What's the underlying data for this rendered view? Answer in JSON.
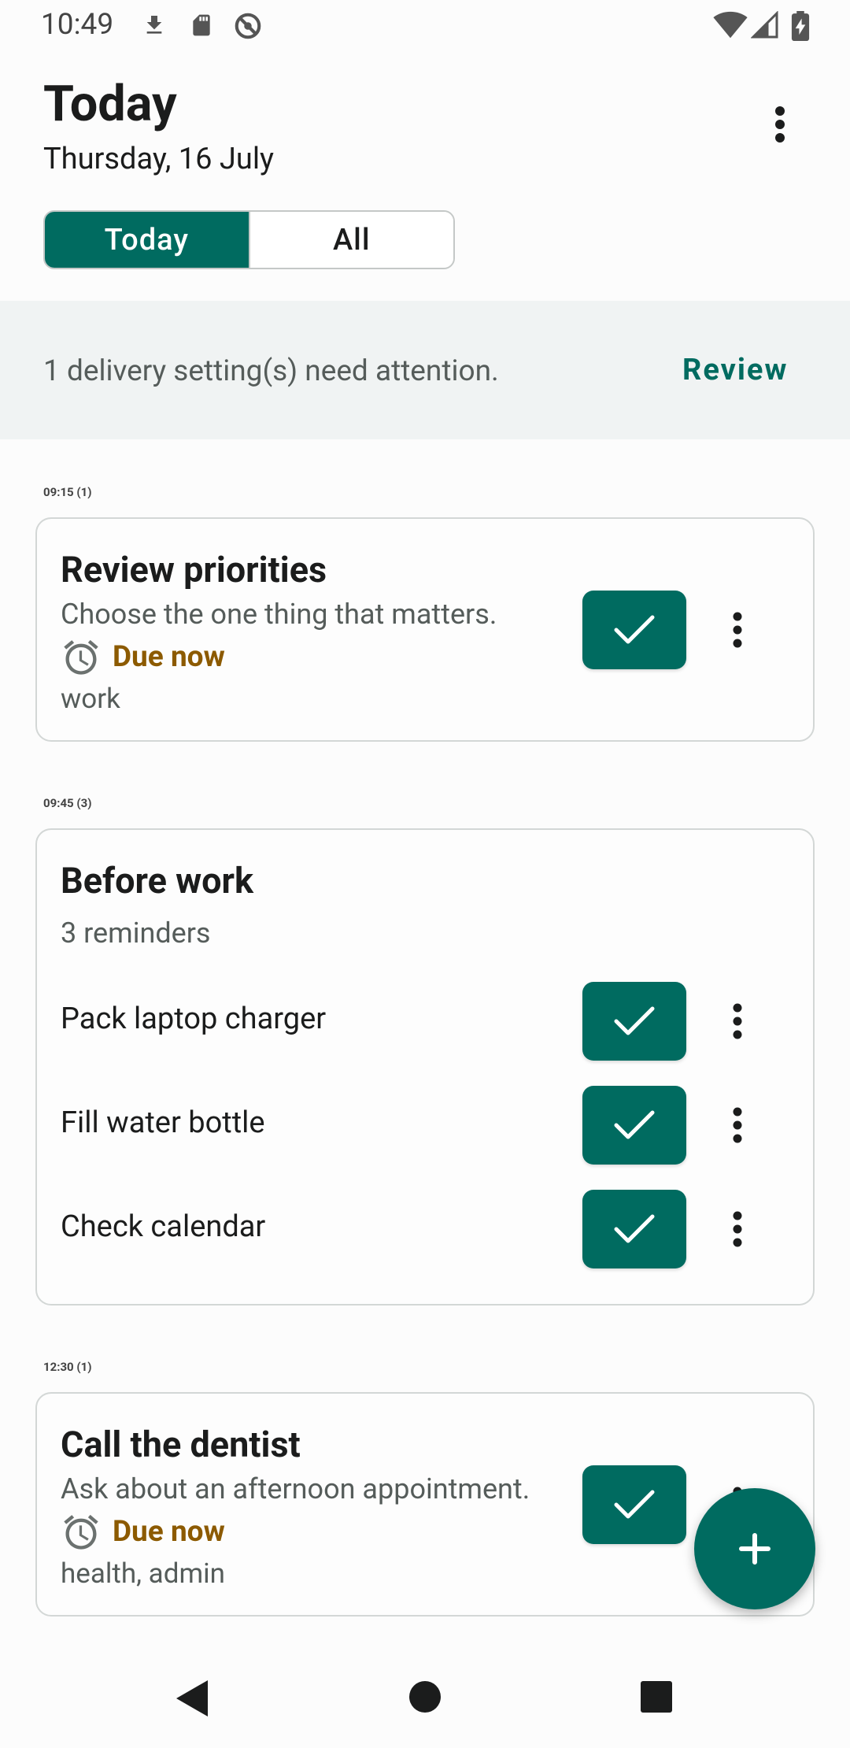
{
  "status_bar": {
    "time": "10:49",
    "left_icons": [
      "download-icon",
      "sd-card-icon",
      "do-not-disturb-icon"
    ],
    "right_icons": [
      "wifi-icon",
      "signal-icon",
      "battery-charging-icon"
    ]
  },
  "header": {
    "title": "Today",
    "date": "Thursday, 16 July"
  },
  "segmented": {
    "today_label": "Today",
    "all_label": "All",
    "selected": "Today"
  },
  "banner": {
    "message": "1 delivery setting(s) need attention.",
    "action_label": "Review"
  },
  "sections": [
    {
      "label": "09:15 (1)",
      "title": "Review priorities",
      "subtitle": "Choose the one thing that matters.",
      "due": "Due now",
      "tags": "work"
    },
    {
      "label": "09:45 (3)",
      "title": "Before work",
      "subtitle": "3 reminders",
      "items": [
        "Pack laptop charger",
        "Fill water bottle",
        "Check calendar"
      ]
    },
    {
      "label": "12:30 (1)",
      "title": "Call the dentist",
      "subtitle": "Ask about an afternoon appointment.",
      "due": "Due now",
      "tags": "health, admin"
    }
  ],
  "colors": {
    "accent": "#006b60",
    "due": "#8c5a00",
    "banner_bg": "#f0f3f3"
  },
  "icons": {
    "check": "check-icon",
    "overflow": "more-vert-icon",
    "alarm": "alarm-icon",
    "fab": "plus-icon",
    "nav": [
      "back-icon",
      "home-icon",
      "recents-icon"
    ]
  }
}
